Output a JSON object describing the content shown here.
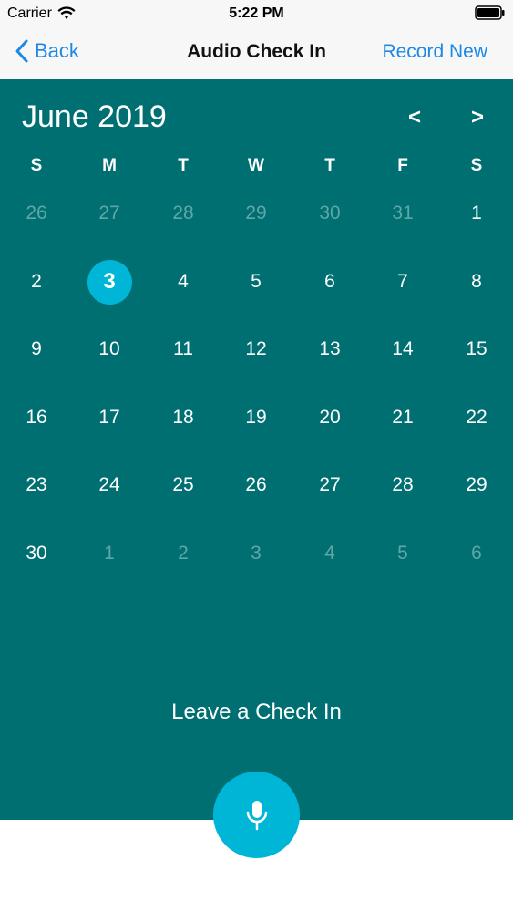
{
  "status_bar": {
    "carrier": "Carrier",
    "time": "5:22 PM"
  },
  "nav": {
    "back_label": "Back",
    "title": "Audio Check In",
    "action_label": "Record New"
  },
  "calendar": {
    "month_label": "June 2019",
    "prev_label": "<",
    "next_label": ">",
    "weekdays": [
      "S",
      "M",
      "T",
      "W",
      "T",
      "F",
      "S"
    ],
    "selected_day": "3",
    "weeks": [
      [
        {
          "d": "26",
          "m": true
        },
        {
          "d": "27",
          "m": true
        },
        {
          "d": "28",
          "m": true
        },
        {
          "d": "29",
          "m": true
        },
        {
          "d": "30",
          "m": true
        },
        {
          "d": "31",
          "m": true
        },
        {
          "d": "1",
          "m": false
        }
      ],
      [
        {
          "d": "2",
          "m": false
        },
        {
          "d": "3",
          "m": false
        },
        {
          "d": "4",
          "m": false
        },
        {
          "d": "5",
          "m": false
        },
        {
          "d": "6",
          "m": false
        },
        {
          "d": "7",
          "m": false
        },
        {
          "d": "8",
          "m": false
        }
      ],
      [
        {
          "d": "9",
          "m": false
        },
        {
          "d": "10",
          "m": false
        },
        {
          "d": "11",
          "m": false
        },
        {
          "d": "12",
          "m": false
        },
        {
          "d": "13",
          "m": false
        },
        {
          "d": "14",
          "m": false
        },
        {
          "d": "15",
          "m": false
        }
      ],
      [
        {
          "d": "16",
          "m": false
        },
        {
          "d": "17",
          "m": false
        },
        {
          "d": "18",
          "m": false
        },
        {
          "d": "19",
          "m": false
        },
        {
          "d": "20",
          "m": false
        },
        {
          "d": "21",
          "m": false
        },
        {
          "d": "22",
          "m": false
        }
      ],
      [
        {
          "d": "23",
          "m": false
        },
        {
          "d": "24",
          "m": false
        },
        {
          "d": "25",
          "m": false
        },
        {
          "d": "26",
          "m": false
        },
        {
          "d": "27",
          "m": false
        },
        {
          "d": "28",
          "m": false
        },
        {
          "d": "29",
          "m": false
        }
      ],
      [
        {
          "d": "30",
          "m": false
        },
        {
          "d": "1",
          "m": true
        },
        {
          "d": "2",
          "m": true
        },
        {
          "d": "3",
          "m": true
        },
        {
          "d": "4",
          "m": true
        },
        {
          "d": "5",
          "m": true
        },
        {
          "d": "6",
          "m": true
        }
      ]
    ]
  },
  "checkin": {
    "label": "Leave a Check In"
  },
  "icons": {
    "back": "chevron-left-icon",
    "mic": "microphone-icon",
    "wifi": "wifi-icon",
    "battery": "battery-icon"
  },
  "colors": {
    "panel": "#006f72",
    "accent": "#00b6d6",
    "link": "#1e88e5",
    "muted_day": "#5fa6a6"
  }
}
